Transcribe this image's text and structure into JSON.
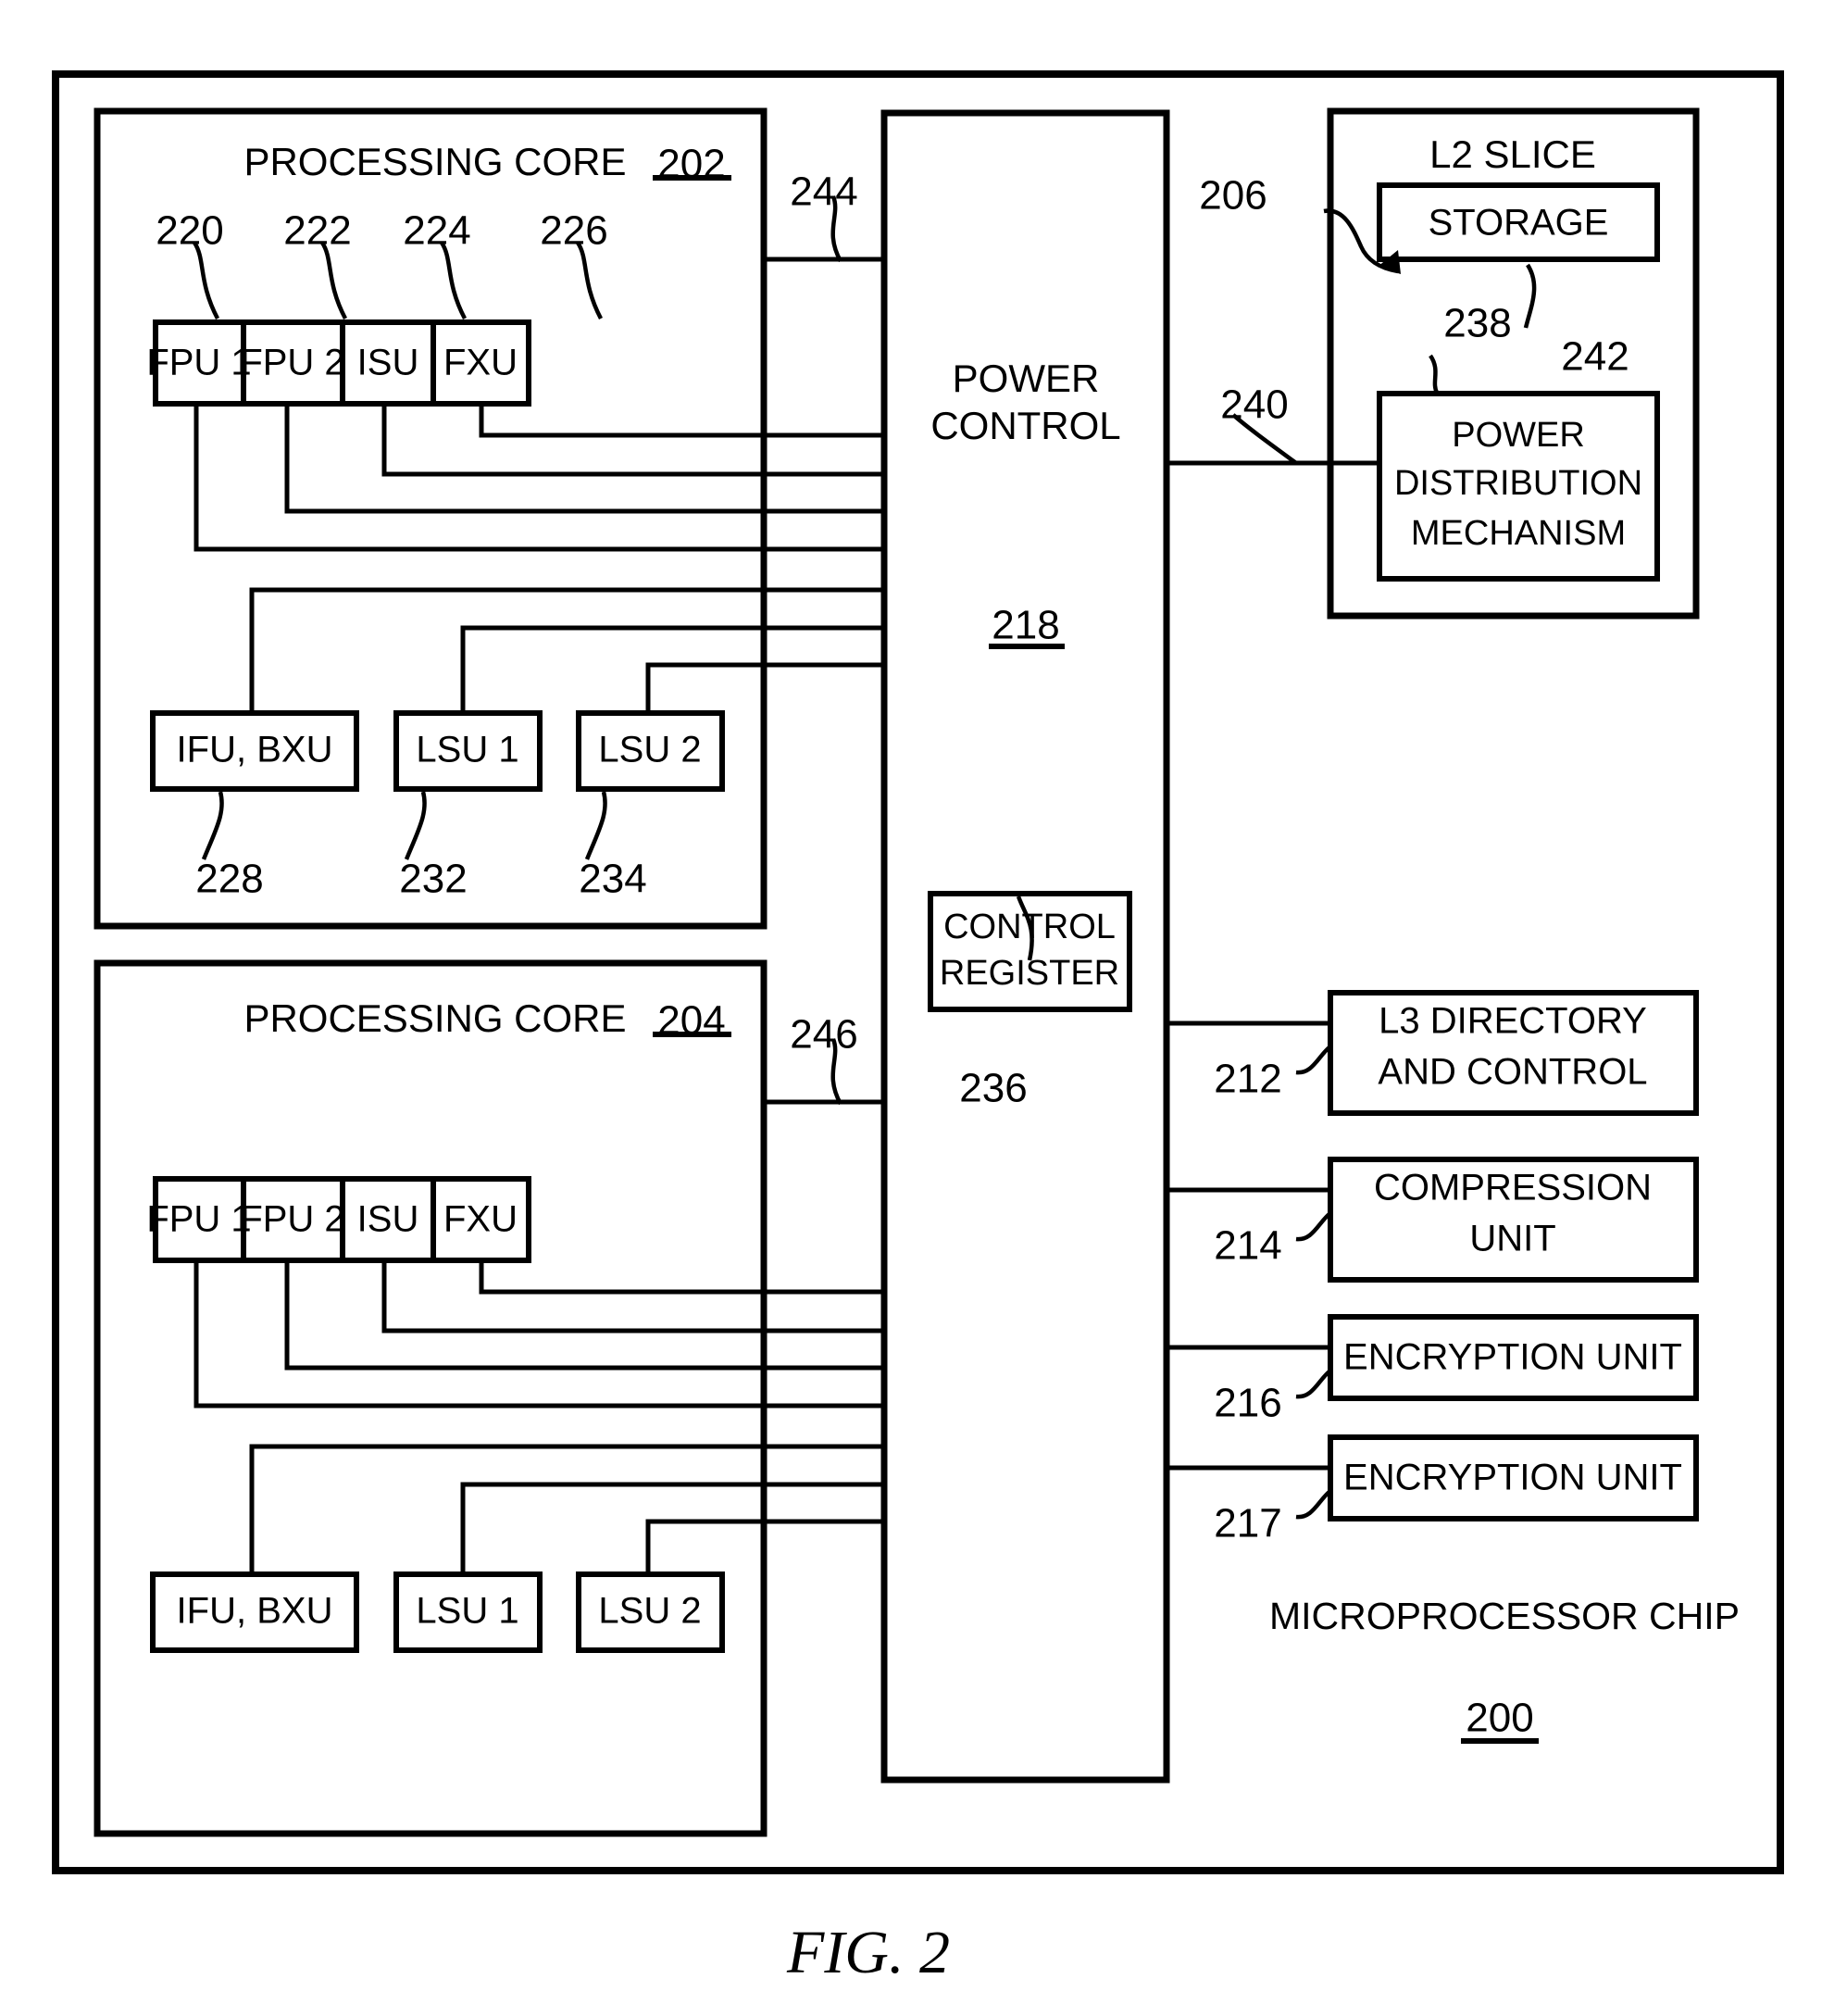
{
  "figure": {
    "caption": "FIG. 2",
    "chip_label": "MICROPROCESSOR CHIP",
    "chip_ref": "200"
  },
  "cores": [
    {
      "title": "PROCESSING CORE",
      "ref": "202",
      "bus_ref": "244",
      "top_units": [
        {
          "label": "FPU 1",
          "ref": "220"
        },
        {
          "label": "FPU 2",
          "ref": "222"
        },
        {
          "label": "ISU",
          "ref": "224"
        },
        {
          "label": "FXU",
          "ref": "226"
        }
      ],
      "bottom_units": [
        {
          "label": "IFU, BXU",
          "ref": "228"
        },
        {
          "label": "LSU 1",
          "ref": "232"
        },
        {
          "label": "LSU 2",
          "ref": "234"
        }
      ]
    },
    {
      "title": "PROCESSING CORE",
      "ref": "204",
      "bus_ref": "246",
      "top_units": [
        {
          "label": "FPU 1",
          "ref": ""
        },
        {
          "label": "FPU 2",
          "ref": ""
        },
        {
          "label": "ISU",
          "ref": ""
        },
        {
          "label": "FXU",
          "ref": ""
        }
      ],
      "bottom_units": [
        {
          "label": "IFU, BXU",
          "ref": ""
        },
        {
          "label": "LSU 1",
          "ref": ""
        },
        {
          "label": "LSU 2",
          "ref": ""
        }
      ]
    }
  ],
  "power_control": {
    "line1": "POWER",
    "line2": "CONTROL",
    "ref": "218",
    "control_register": {
      "line1": "CONTROL",
      "line2": "REGISTER",
      "ref": "236"
    }
  },
  "l2_slice": {
    "title": "L2 SLICE",
    "ref": "206",
    "link_ref": "240",
    "storage": {
      "label": "STORAGE",
      "ref": "242"
    },
    "pdm": {
      "line1": "POWER",
      "line2": "DISTRIBUTION",
      "line3": "MECHANISM",
      "ref": "238"
    }
  },
  "right_units": [
    {
      "line1": "L3 DIRECTORY",
      "line2": "AND CONTROL",
      "ref": "212"
    },
    {
      "line1": "COMPRESSION",
      "line2": "UNIT",
      "ref": "214"
    },
    {
      "line1": "ENCRYPTION UNIT",
      "line2": "",
      "ref": "216"
    },
    {
      "line1": "ENCRYPTION UNIT",
      "line2": "",
      "ref": "217"
    }
  ],
  "colors": {
    "ink": "#000000",
    "paper": "#ffffff"
  }
}
